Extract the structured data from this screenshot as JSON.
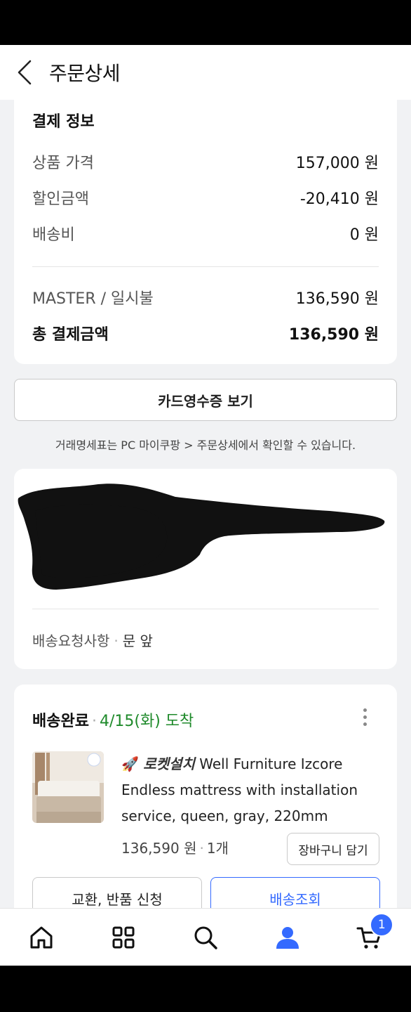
{
  "header": {
    "title": "주문상세"
  },
  "payment": {
    "title": "결제 정보",
    "rows": [
      {
        "label": "상품 가격",
        "value": "157,000 원"
      },
      {
        "label": "할인금액",
        "value": "-20,410 원"
      },
      {
        "label": "배송비",
        "value": "0 원"
      }
    ],
    "method": {
      "label": "MASTER / 일시불",
      "value": "136,590 원"
    },
    "total": {
      "label": "총 결제금액",
      "value": "136,590 원"
    }
  },
  "receipt_button": "카드영수증 보기",
  "notice": "거래명세표는 PC 마이쿠팡 > 주문상세에서 확인할 수 있습니다.",
  "address": {
    "request_label": "배송요청사항",
    "request_value": "문 앞"
  },
  "delivery": {
    "status": "배송완료",
    "date": "4/15(화) 도착",
    "product": {
      "badge": "로켓설치",
      "name": "Well Furniture Izcore Endless mattress with installation service, queen, gray, 220mm",
      "price": "136,590 원",
      "quantity": "1개"
    },
    "add_to_cart": "장바구니 담기",
    "return_button": "교환, 반품 신청",
    "track_button": "배송조회"
  },
  "nav": {
    "items": [
      "home-icon",
      "categories-icon",
      "search-icon",
      "my-page-icon",
      "cart-icon"
    ],
    "cart_count": "1"
  },
  "colors": {
    "accent": "#346aff",
    "delivered": "#1f8a2b"
  }
}
